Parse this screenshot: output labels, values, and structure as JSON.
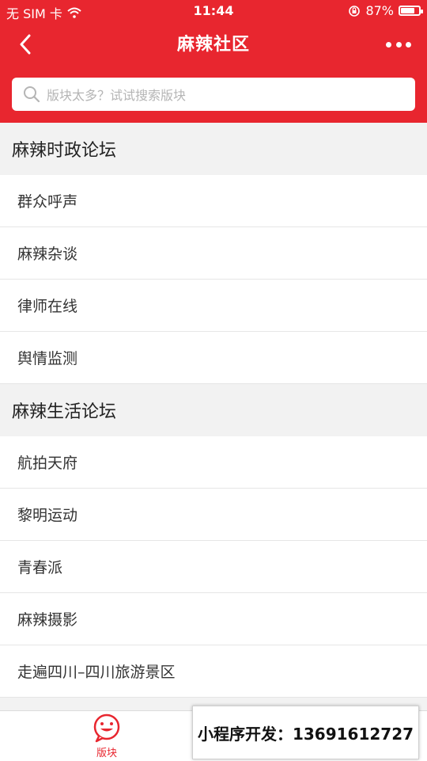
{
  "status_bar": {
    "carrier": "无 SIM 卡",
    "time": "11:44",
    "battery_percent": "87%",
    "battery_level": 0.87
  },
  "navbar": {
    "title": "麻辣社区"
  },
  "search": {
    "placeholder": "版块太多？试试搜索版块"
  },
  "sections": [
    {
      "title": "麻辣时政论坛",
      "items": [
        "群众呼声",
        "麻辣杂谈",
        "律师在线",
        "舆情监测"
      ]
    },
    {
      "title": "麻辣生活论坛",
      "items": [
        "航拍天府",
        "黎明运动",
        "青春派",
        "麻辣摄影",
        "走遍四川–四川旅游景区"
      ]
    }
  ],
  "tabbar": {
    "active_tab_label": "版块"
  },
  "promo": {
    "text": "小程序开发：13691612727"
  },
  "colors": {
    "accent": "#e8262f",
    "section_bg": "#f2f2f2"
  }
}
